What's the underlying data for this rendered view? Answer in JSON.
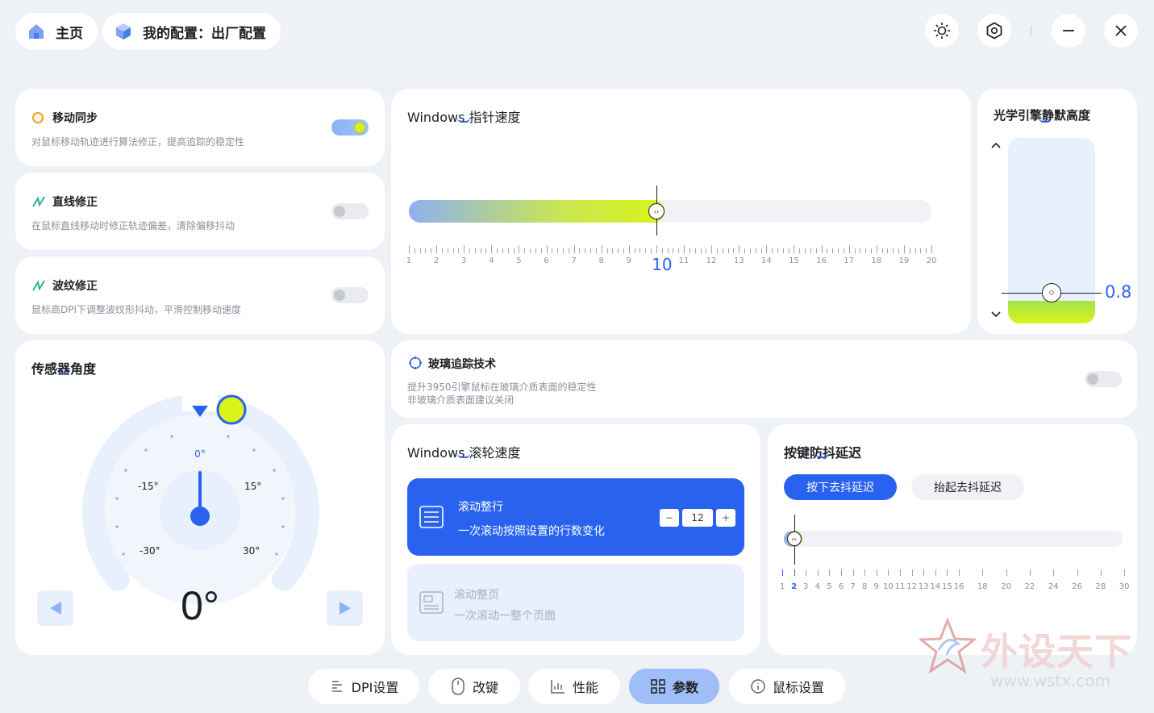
{
  "topbar": {
    "home_label": "主页",
    "profile_label": "我的配置：出厂配置"
  },
  "motion_sync": {
    "title": "移动同步",
    "desc": "对鼠标移动轨迹进行算法修正，提高追踪的稳定性",
    "enabled": true
  },
  "line_correction": {
    "title": "直线修正",
    "desc": "在鼠标直线移动时修正轨迹偏差，清除偏移抖动",
    "enabled": false
  },
  "ripple_correction": {
    "title": "波纹修正",
    "desc": "鼠标高DPI下调整波纹形抖动，平滑控制移动速度",
    "enabled": false
  },
  "pointer_speed": {
    "title": "Windows 指针速度",
    "value": "10",
    "value_num": 10,
    "min": 1,
    "max": 20,
    "ticks": [
      "1",
      "2",
      "3",
      "4",
      "5",
      "6",
      "7",
      "8",
      "9",
      "10",
      "11",
      "12",
      "13",
      "14",
      "15",
      "16",
      "17",
      "18",
      "19",
      "20"
    ]
  },
  "lod": {
    "title": "光学引擎静默高度",
    "value": "0.8",
    "fraction": 0.12
  },
  "sensor_angle": {
    "title": "传感器角度",
    "value": "0°",
    "labels": {
      "zero": "0°",
      "m15": "-15°",
      "p15": "15°",
      "m30": "-30°",
      "p30": "30°"
    }
  },
  "glass_tracking": {
    "title": "玻璃追踪技术",
    "desc1": "提升3950引擎鼠标在玻璃介质表面的稳定性",
    "desc2": "非玻璃介质表面建议关闭",
    "enabled": false
  },
  "scroll_speed": {
    "title": "Windows 滚轮速度",
    "line_title": "滚动整行",
    "line_desc": "一次滚动按照设置的行数变化",
    "line_value": "12",
    "minus": "−",
    "plus": "+",
    "page_title": "滚动整页",
    "page_desc": "一次滚动一整个页面"
  },
  "debounce": {
    "title": "按键防抖延迟",
    "tab_press": "按下去抖延迟",
    "tab_release": "抬起去抖延迟",
    "value_num": 2,
    "ticks": [
      "1",
      "2",
      "3",
      "4",
      "5",
      "6",
      "7",
      "8",
      "9",
      "10",
      "11",
      "12",
      "13",
      "14",
      "15",
      "16",
      "18",
      "20",
      "22",
      "24",
      "26",
      "28",
      "30"
    ]
  },
  "bottom_nav": [
    {
      "label": "DPI设置",
      "icon": "dpi-icon"
    },
    {
      "label": "改键",
      "icon": "mouse-icon"
    },
    {
      "label": "性能",
      "icon": "chart-icon"
    },
    {
      "label": "参数",
      "icon": "grid-icon"
    },
    {
      "label": "鼠标设置",
      "icon": "info-icon"
    }
  ],
  "watermark": {
    "text": "外设天下",
    "url": "www.wstx.com"
  },
  "colors": {
    "accent": "#2a62f0",
    "lime": "#d7f01e",
    "bg": "#eef1f6"
  }
}
